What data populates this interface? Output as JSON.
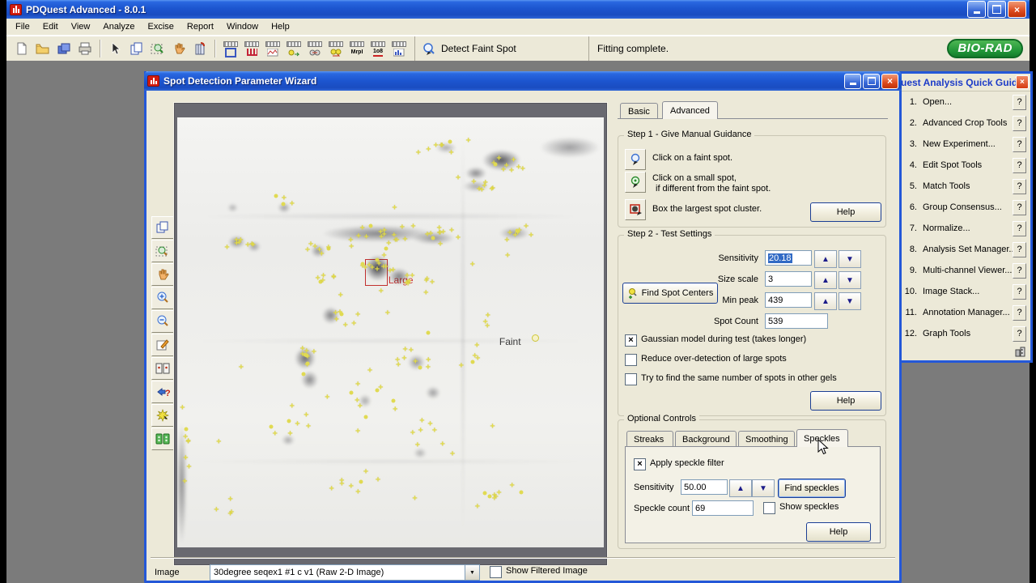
{
  "app": {
    "title": "PDQuest Advanced - 8.0.1",
    "status": "Fitting complete.",
    "brand": "BIO-RAD"
  },
  "menu": {
    "items": [
      "File",
      "Edit",
      "View",
      "Analyze",
      "Excise",
      "Report",
      "Window",
      "Help"
    ]
  },
  "toolbar": {
    "detect_label": "Detect Faint Spot",
    "mrp_icon_text": "MrpI",
    "lo8_icon_text": "1o8"
  },
  "wizard": {
    "title": "Spot Detection Parameter Wizard",
    "tabs": {
      "basic": "Basic",
      "advanced": "Advanced"
    },
    "step1": {
      "title": "Step 1 - Give Manual Guidance",
      "faint_line": "Click on a faint spot.",
      "small_line1": "Click on a small spot,",
      "small_line2": "if different from the faint spot.",
      "box_line": "Box the largest spot cluster.",
      "help": "Help"
    },
    "step2": {
      "title": "Step 2 - Test Settings",
      "find_button": "Find Spot Centers",
      "sensitivity_label": "Sensitivity",
      "sensitivity_value": "20.18",
      "size_scale_label": "Size scale",
      "size_scale_value": "3",
      "min_peak_label": "Min peak",
      "min_peak_value": "439",
      "spot_count_label": "Spot Count",
      "spot_count_value": "539",
      "check1": "Gaussian model during test (takes longer)",
      "check2": "Reduce over-detection of large spots",
      "check3": "Try to find the same number of spots in other gels",
      "help": "Help"
    },
    "optional": {
      "title": "Optional Controls",
      "tabs": [
        "Streaks",
        "Background",
        "Smoothing",
        "Speckles"
      ],
      "apply_label": "Apply speckle filter",
      "sensitivity_label": "Sensitivity",
      "sensitivity_value": "50.00",
      "find_speckles": "Find speckles",
      "speckle_count_label": "Speckle count",
      "speckle_count_value": "69",
      "show_speckles": "Show speckles",
      "help": "Help"
    },
    "image_row": {
      "label": "Image",
      "value": "30degree seqex1 #1 c v1 (Raw 2-D Image)",
      "show_filtered": "Show Filtered Image"
    },
    "gel": {
      "large_label": "Large",
      "faint_label": "Faint",
      "marker_clusters": [
        [
          63,
          7,
          8,
          7,
          2
        ],
        [
          77,
          11,
          9,
          5,
          2
        ],
        [
          69,
          16,
          8,
          7,
          2
        ],
        [
          25,
          20,
          4,
          5,
          2
        ],
        [
          15,
          29,
          8,
          5,
          2
        ],
        [
          33,
          30,
          6,
          4,
          2
        ],
        [
          48,
          28,
          16,
          9,
          3
        ],
        [
          62,
          27,
          9,
          6,
          2
        ],
        [
          79,
          27,
          8,
          6,
          2
        ],
        [
          47,
          34,
          13,
          6,
          3
        ],
        [
          57,
          38,
          8,
          5,
          3
        ],
        [
          38,
          45,
          8,
          5,
          4
        ],
        [
          30,
          55,
          10,
          6,
          5
        ],
        [
          55,
          57,
          8,
          6,
          4
        ],
        [
          70,
          55,
          5,
          5,
          4
        ],
        [
          45,
          65,
          8,
          8,
          5
        ],
        [
          25,
          72,
          7,
          7,
          5
        ],
        [
          60,
          75,
          7,
          8,
          5
        ],
        [
          40,
          85,
          8,
          10,
          4
        ],
        [
          75,
          88,
          8,
          8,
          3
        ],
        [
          2,
          75,
          8,
          1,
          12
        ],
        [
          12,
          90,
          4,
          5,
          3
        ],
        [
          35,
          38,
          6,
          4,
          3
        ],
        [
          50,
          50,
          26,
          46,
          44
        ]
      ],
      "blobs": [
        [
          76,
          10,
          9,
          5,
          0.75
        ],
        [
          70,
          13,
          5,
          3,
          0.5
        ],
        [
          47,
          27,
          26,
          4,
          0.5
        ],
        [
          60,
          28,
          10,
          3,
          0.45
        ],
        [
          79,
          27,
          7,
          3,
          0.4
        ],
        [
          47,
          35,
          6,
          6,
          0.85
        ],
        [
          52,
          37,
          5,
          4,
          0.55
        ],
        [
          14,
          29,
          4,
          3,
          0.5
        ],
        [
          18,
          30,
          3,
          2.5,
          0.4
        ],
        [
          33,
          31,
          3.5,
          3,
          0.45
        ],
        [
          25,
          21,
          3,
          2.5,
          0.4
        ],
        [
          13,
          21,
          2.5,
          2,
          0.3
        ],
        [
          36,
          46,
          4,
          4,
          0.55
        ],
        [
          30,
          56,
          5,
          5,
          0.65
        ],
        [
          31,
          61,
          4,
          4,
          0.5
        ],
        [
          56,
          57,
          4,
          3.5,
          0.45
        ],
        [
          60,
          64,
          3.5,
          3,
          0.4
        ],
        [
          44,
          66,
          3,
          3,
          0.35
        ],
        [
          26,
          75,
          3,
          2.5,
          0.35
        ],
        [
          57,
          78,
          3,
          2.5,
          0.3
        ],
        [
          70,
          16,
          6,
          2.5,
          0.35
        ],
        [
          63,
          7,
          5,
          2.5,
          0.35
        ],
        [
          92,
          7,
          14,
          5,
          0.4
        ],
        [
          1,
          85,
          2.5,
          28,
          0.45
        ],
        [
          67,
          50,
          1.2,
          95,
          0.12
        ],
        [
          50,
          23,
          90,
          1.5,
          0.12
        ],
        [
          50,
          52,
          95,
          1,
          0.08
        ],
        [
          50,
          80,
          95,
          1.2,
          0.08
        ]
      ]
    }
  },
  "quick_guide": {
    "title": "uest Analysis Quick Guide",
    "help_glyph": "?",
    "items": [
      "Open...",
      "Advanced Crop Tools",
      "New Experiment...",
      "Edit Spot Tools",
      "Match Tools",
      "Group Consensus...",
      "Normalize...",
      "Analysis Set Manager...",
      "Multi-channel Viewer...",
      "Image Stack...",
      "Annotation Manager...",
      "Graph Tools"
    ]
  }
}
